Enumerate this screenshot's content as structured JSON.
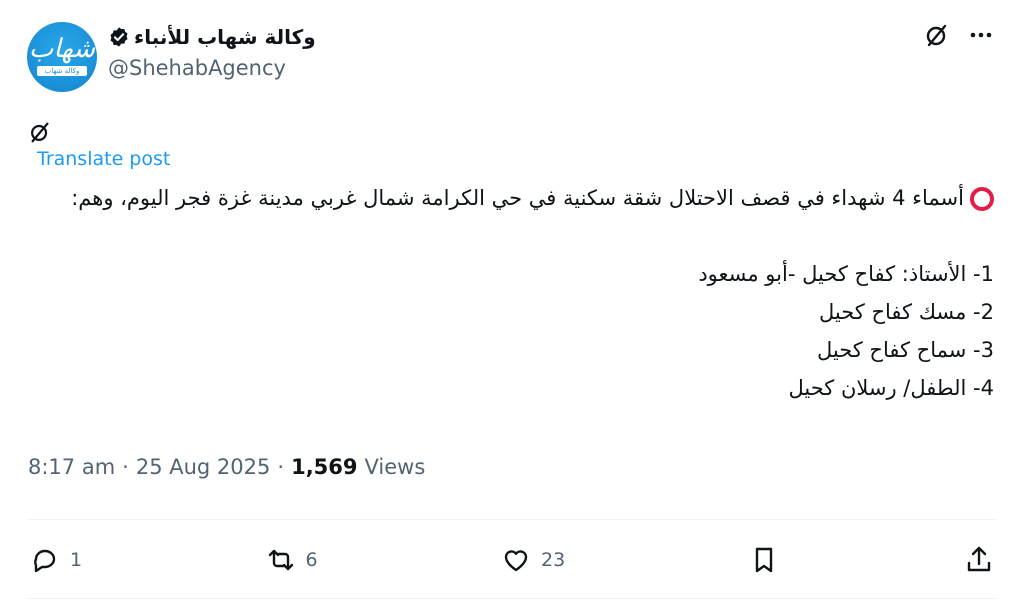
{
  "author": {
    "display_name": "وكالة شهاب للأنباء",
    "handle": "@ShehabAgency",
    "avatar_text": "شهاب",
    "avatar_caption": "وكالة شهاب للأنباء",
    "verified": true
  },
  "top_actions": [
    "grok-icon",
    "more-icon"
  ],
  "translate_label": "Translate post",
  "tweet": {
    "line1": "أسماء 4 شهداء في قصف الاحتلال شقة سكنية في حي الكرامة شمال غربي مدينة غزة فجر اليوم، وهم:",
    "items": [
      "1- الأستاذ: كفاح كحيل -أبو مسعود",
      "2- مسك كفاح كحيل",
      "3- سماح كفاح كحيل",
      "4- الطفل/ رسلان كحيل"
    ]
  },
  "meta": {
    "time": "8:17 am",
    "sep": "·",
    "date": "25 Aug 2025",
    "views_count": "1,569",
    "views_label": "Views"
  },
  "actions": {
    "replies": "1",
    "reposts": "6",
    "likes": "23"
  },
  "colors": {
    "accent": "#1d9bf0",
    "text": "#0f1419",
    "muted": "#536471",
    "emoji_red": "#e11d48"
  }
}
